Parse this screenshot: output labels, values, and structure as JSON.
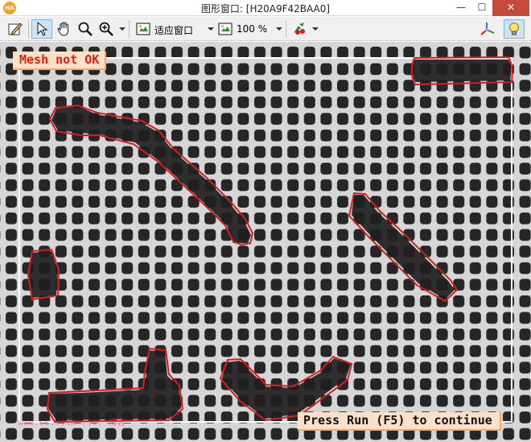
{
  "window": {
    "app_logo_text": "HA",
    "title": "图形窗口: [H20A9F42BAA0]",
    "minimize_glyph": "—",
    "maximize_glyph": "☐",
    "close_glyph": "✕"
  },
  "toolbar": {
    "icons": [
      "edit-icon",
      "pointer-icon",
      "hand-pan-icon",
      "magnify-icon",
      "zoom-in-icon",
      "fit-window-icon",
      "zoom-percent-icon",
      "color-palette-icon",
      "3d-axis-icon",
      "lightbulb-icon"
    ],
    "fit_mode": "适应窗口",
    "zoom": "100 %"
  },
  "canvas": {
    "status_label": "Mesh not OK",
    "continue_label": "Press Run (F5) to continue",
    "watermark": "www.cs...tm .... 博客",
    "defect_color": "#d81c1c",
    "roi_color": "#ffffff",
    "mesh_hole_color": "#262626",
    "mesh_wire_color": "#d6d6d6"
  }
}
